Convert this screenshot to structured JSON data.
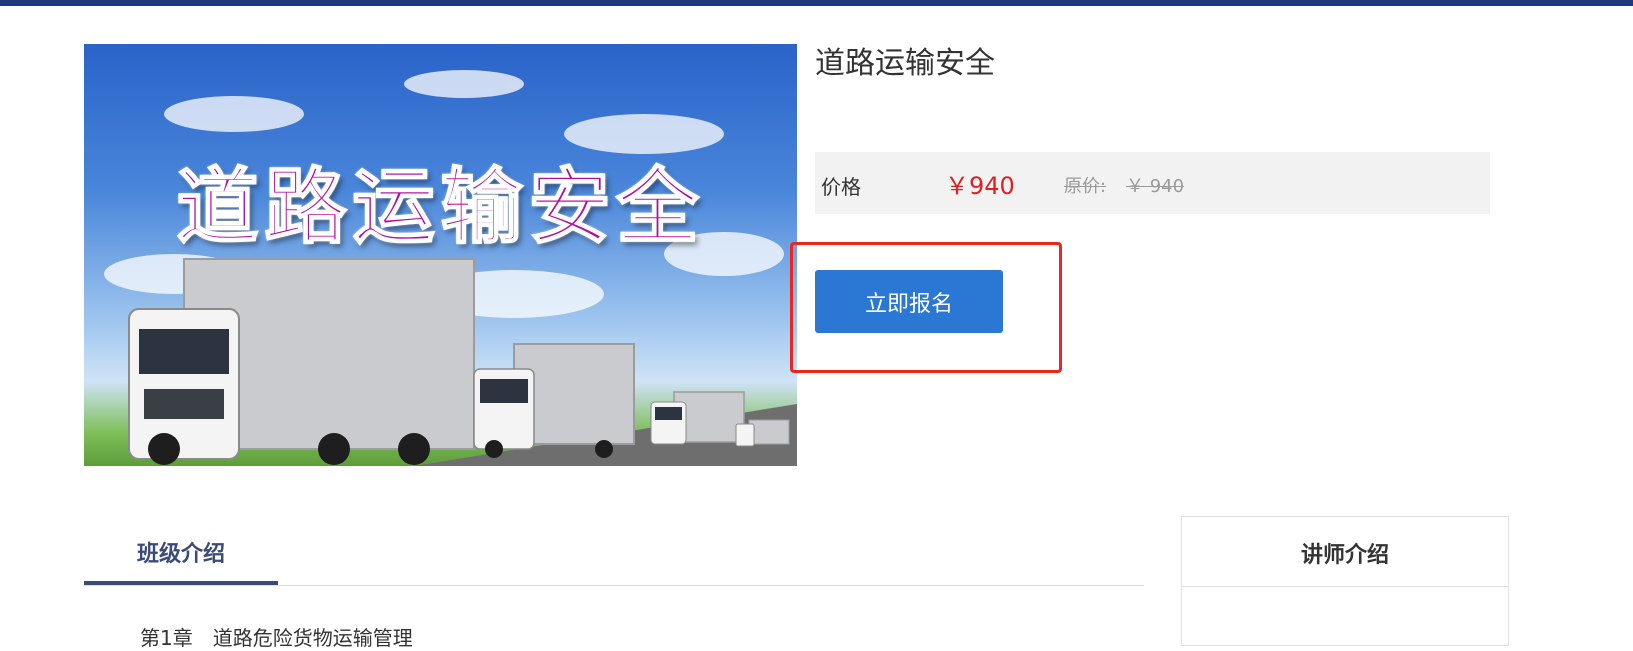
{
  "course": {
    "image_banner_text": "道路运输安全",
    "title": "道路运输安全"
  },
  "price": {
    "label": "价格",
    "current": "￥940",
    "original_label": "原价:",
    "original": "￥ 940"
  },
  "actions": {
    "enroll_label": "立即报名"
  },
  "tabs": [
    {
      "label": "班级介绍",
      "active": true
    }
  ],
  "content": {
    "chapter_line": "第1章　道路危险货物运输管理"
  },
  "instructor": {
    "header": "讲师介绍"
  },
  "colors": {
    "top_bar": "#1f3a7a",
    "accent_blue": "#2b77d4",
    "price_red": "#e02020",
    "highlight_red": "#e8281e",
    "tab_active": "#3c4a78"
  }
}
